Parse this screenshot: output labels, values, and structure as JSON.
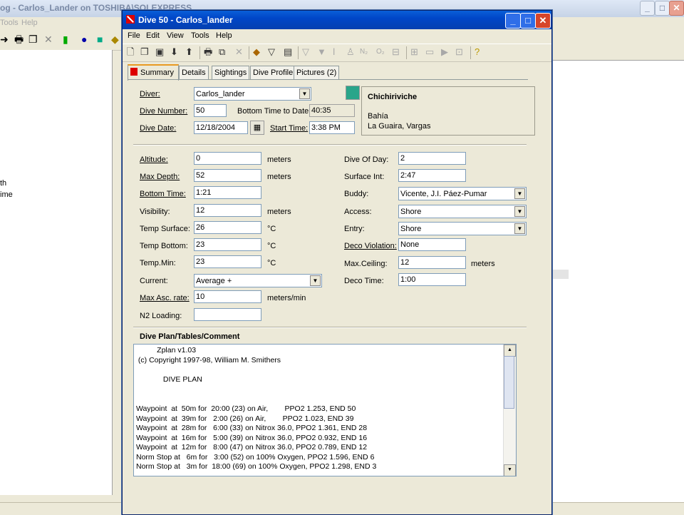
{
  "background": {
    "title": "og - Carlos_Lander on TOSHIBA\\SOLEXPRESS",
    "menu": [
      "Tools",
      "Help"
    ],
    "left_items": [
      "th",
      "ime"
    ]
  },
  "dialog": {
    "title": "Dive 50 - Carlos_lander",
    "menu": [
      "File",
      "Edit",
      "View",
      "Tools",
      "Help"
    ],
    "tabs": [
      "Summary",
      "Details",
      "Sightings",
      "Dive Profile",
      "Pictures (2)"
    ],
    "header": {
      "diver_label": "Diver:",
      "diver_value": "Carlos_lander",
      "dive_number_label": "Dive Number:",
      "dive_number_value": "50",
      "bottom_time_to_date_label": "Bottom Time to Date:",
      "bottom_time_to_date_value": "40:35",
      "dive_date_label": "Dive Date:",
      "dive_date_value": "12/18/2004",
      "start_time_label": "Start Time:",
      "start_time_value": "3:38 PM"
    },
    "location": {
      "name": "Chichiriviche",
      "line1": "Bahía",
      "line2": "La Guaira, Vargas"
    },
    "left_fields": [
      {
        "label": "Altitude:",
        "value": "0",
        "unit": "meters"
      },
      {
        "label": "Max Depth:",
        "value": "52",
        "unit": "meters"
      },
      {
        "label": "Bottom Time:",
        "value": "1:21",
        "unit": ""
      },
      {
        "label": "Visibility:",
        "value": "12",
        "unit": "meters"
      },
      {
        "label": "Temp Surface:",
        "value": "26",
        "unit": "°C"
      },
      {
        "label": "Temp Bottom:",
        "value": "23",
        "unit": "°C"
      },
      {
        "label": "Temp.Min:",
        "value": "23",
        "unit": "°C"
      },
      {
        "label": "Current:",
        "value": "Average +",
        "unit": ""
      },
      {
        "label": "Max Asc. rate:",
        "value": "10",
        "unit": "meters/min"
      },
      {
        "label": "N2 Loading:",
        "value": "",
        "unit": ""
      }
    ],
    "right_fields": [
      {
        "label": "Dive Of Day:",
        "value": "2",
        "unit": ""
      },
      {
        "label": "Surface Int:",
        "value": "2:47",
        "unit": ""
      },
      {
        "label": "Buddy:",
        "value": "Vicente, J.I. Páez-Pumar",
        "unit": ""
      },
      {
        "label": "Access:",
        "value": "Shore",
        "unit": ""
      },
      {
        "label": "Entry:",
        "value": "Shore",
        "unit": ""
      },
      {
        "label": "Deco Violation:",
        "value": "None",
        "unit": ""
      },
      {
        "label": "Max.Ceiling:",
        "value": "12",
        "unit": "meters"
      },
      {
        "label": "Deco Time:",
        "value": "1:00",
        "unit": ""
      }
    ],
    "plan_title": "Dive Plan/Tables/Comment",
    "plan_lines": [
      "          Zplan v1.03",
      " (c) Copyright 1997-98, William M. Smithers",
      "",
      "             DIVE PLAN",
      "",
      "Waypoint  at  50m for  20:00 (23) on Air,        PPO2 1.253, END 50",
      "Waypoint  at  39m for   2:00 (26) on Air,        PPO2 1.023, END 39",
      "Waypoint  at  28m for   6:00 (33) on Nitrox 36.0, PPO2 1.361, END 28",
      "Waypoint  at  16m for   5:00 (39) on Nitrox 36.0, PPO2 0.932, END 16",
      "Waypoint  at  12m for   8:00 (47) on Nitrox 36.0, PPO2 0.789, END 12",
      "Norm Stop at   6m for   3:00 (52) on 100% Oxygen, PPO2 1.596, END 6",
      "Norm Stop at   3m for  18:00 (69) on 100% Oxygen, PPO2 1.298, END 3"
    ]
  }
}
